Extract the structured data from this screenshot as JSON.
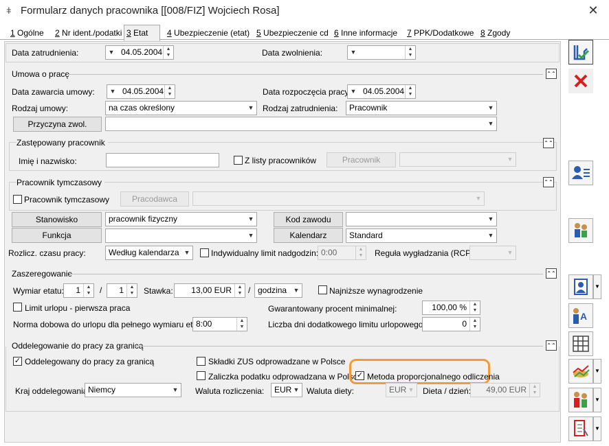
{
  "window": {
    "title": "Formularz danych pracownika [[008/FIZ] Wojciech Rosa]",
    "close": "✕"
  },
  "tabs": [
    {
      "num": "1",
      "label": " Ogólne"
    },
    {
      "num": "2",
      "label": " Nr ident./podatki"
    },
    {
      "num": "3",
      "label": " Etat"
    },
    {
      "num": "4",
      "label": " Ubezpieczenie (etat)"
    },
    {
      "num": "5",
      "label": " Ubezpieczenie cd"
    },
    {
      "num": "6",
      "label": " Inne informacje"
    },
    {
      "num": "7",
      "label": " PPK/Dodatkowe"
    },
    {
      "num": "8",
      "label": " Zgody"
    }
  ],
  "top": {
    "data_zatrudnienia_label": "Data zatrudnienia:",
    "data_zatrudnienia": "04.05.2004",
    "data_zwolnienia_label": "Data zwolnienia:",
    "data_zwolnienia": ""
  },
  "umowa": {
    "title": "Umowa o pracę",
    "data_zawarcia_label": "Data zawarcia umowy:",
    "data_zawarcia": "04.05.2004",
    "data_rozpoczecia_label": "Data rozpoczęcia pracy:",
    "data_rozpoczecia": "04.05.2004",
    "rodzaj_umowy_label": "Rodzaj umowy:",
    "rodzaj_umowy": "na czas określony",
    "rodzaj_zatrudnienia_label": "Rodzaj zatrudnienia:",
    "rodzaj_zatrudnienia": "Pracownik",
    "przyczyna_btn": "Przyczyna zwol.",
    "przyczyna": ""
  },
  "zastepowany": {
    "title": "Zastępowany pracownik",
    "imie_label": "Imię i nazwisko:",
    "imie": "",
    "z_listy_label": "Z listy pracowników",
    "pracownik_btn": "Pracownik"
  },
  "tymczasowy": {
    "title": "Pracownik tymczasowy",
    "chk_label": "Pracownik tymczasowy",
    "pracodawca_btn": "Pracodawca"
  },
  "stanowisko": {
    "stanowisko_btn": "Stanowisko",
    "stanowisko": "pracownik fizyczny",
    "kod_btn": "Kod zawodu",
    "kod": "",
    "funkcja_btn": "Funkcja",
    "funkcja": "",
    "kalendarz_btn": "Kalendarz",
    "kalendarz": "Standard",
    "rozlicz_label": "Rozlicz. czasu pracy:",
    "rozlicz": "Według kalendarza",
    "indywidualny_label": "Indywidualny limit nadgodzin:",
    "indywidualny": "0:00",
    "regula_label": "Reguła wygładzania (RCP):"
  },
  "zaszeregowanie": {
    "title": "Zaszeregowanie",
    "wymiar_label": "Wymiar etatu:",
    "wymiar_licznik": "1",
    "slash": "/",
    "wymiar_mianownik": "1",
    "stawka_label": "Stawka:",
    "stawka": "13,00 EUR",
    "slash2": "/",
    "jednostka": "godzina",
    "najnizsze_label": "Najniższe wynagrodzenie",
    "limit_label": "Limit urlopu - pierwsza praca",
    "gwarantowany_label": "Gwarantowany procent minimalnej:",
    "gwarantowany": "100,00 %",
    "norma_label": "Norma dobowa do urlopu dla pełnego wymiaru etatu:",
    "norma": "8:00",
    "liczba_dni_label": "Liczba dni dodatkowego limitu urlopowego:",
    "liczba_dni": "0"
  },
  "oddelegowanie": {
    "title": "Oddelegowanie do pracy za granicą",
    "oddelegowany_label": "Oddelegowany do pracy za granicą",
    "skladki_label": "Składki ZUS odprowadzane w Polsce",
    "zaliczka_label": "Zaliczka podatku odprowadzana w Polsce",
    "metoda_label": "Metoda proporcjonalnego odliczenia",
    "kraj_label": "Kraj oddelegowania:",
    "kraj": "Niemcy",
    "waluta_rozl_label": "Waluta rozliczenia:",
    "waluta_rozl": "EUR",
    "waluta_diety_label": "Waluta diety:",
    "waluta_diety": "EUR",
    "dieta_label": "Dieta / dzień:",
    "dieta": "49,00 EUR"
  },
  "colors": {
    "accent": "#f39a37",
    "save": "#2a5db0",
    "cancel": "#d62020"
  }
}
